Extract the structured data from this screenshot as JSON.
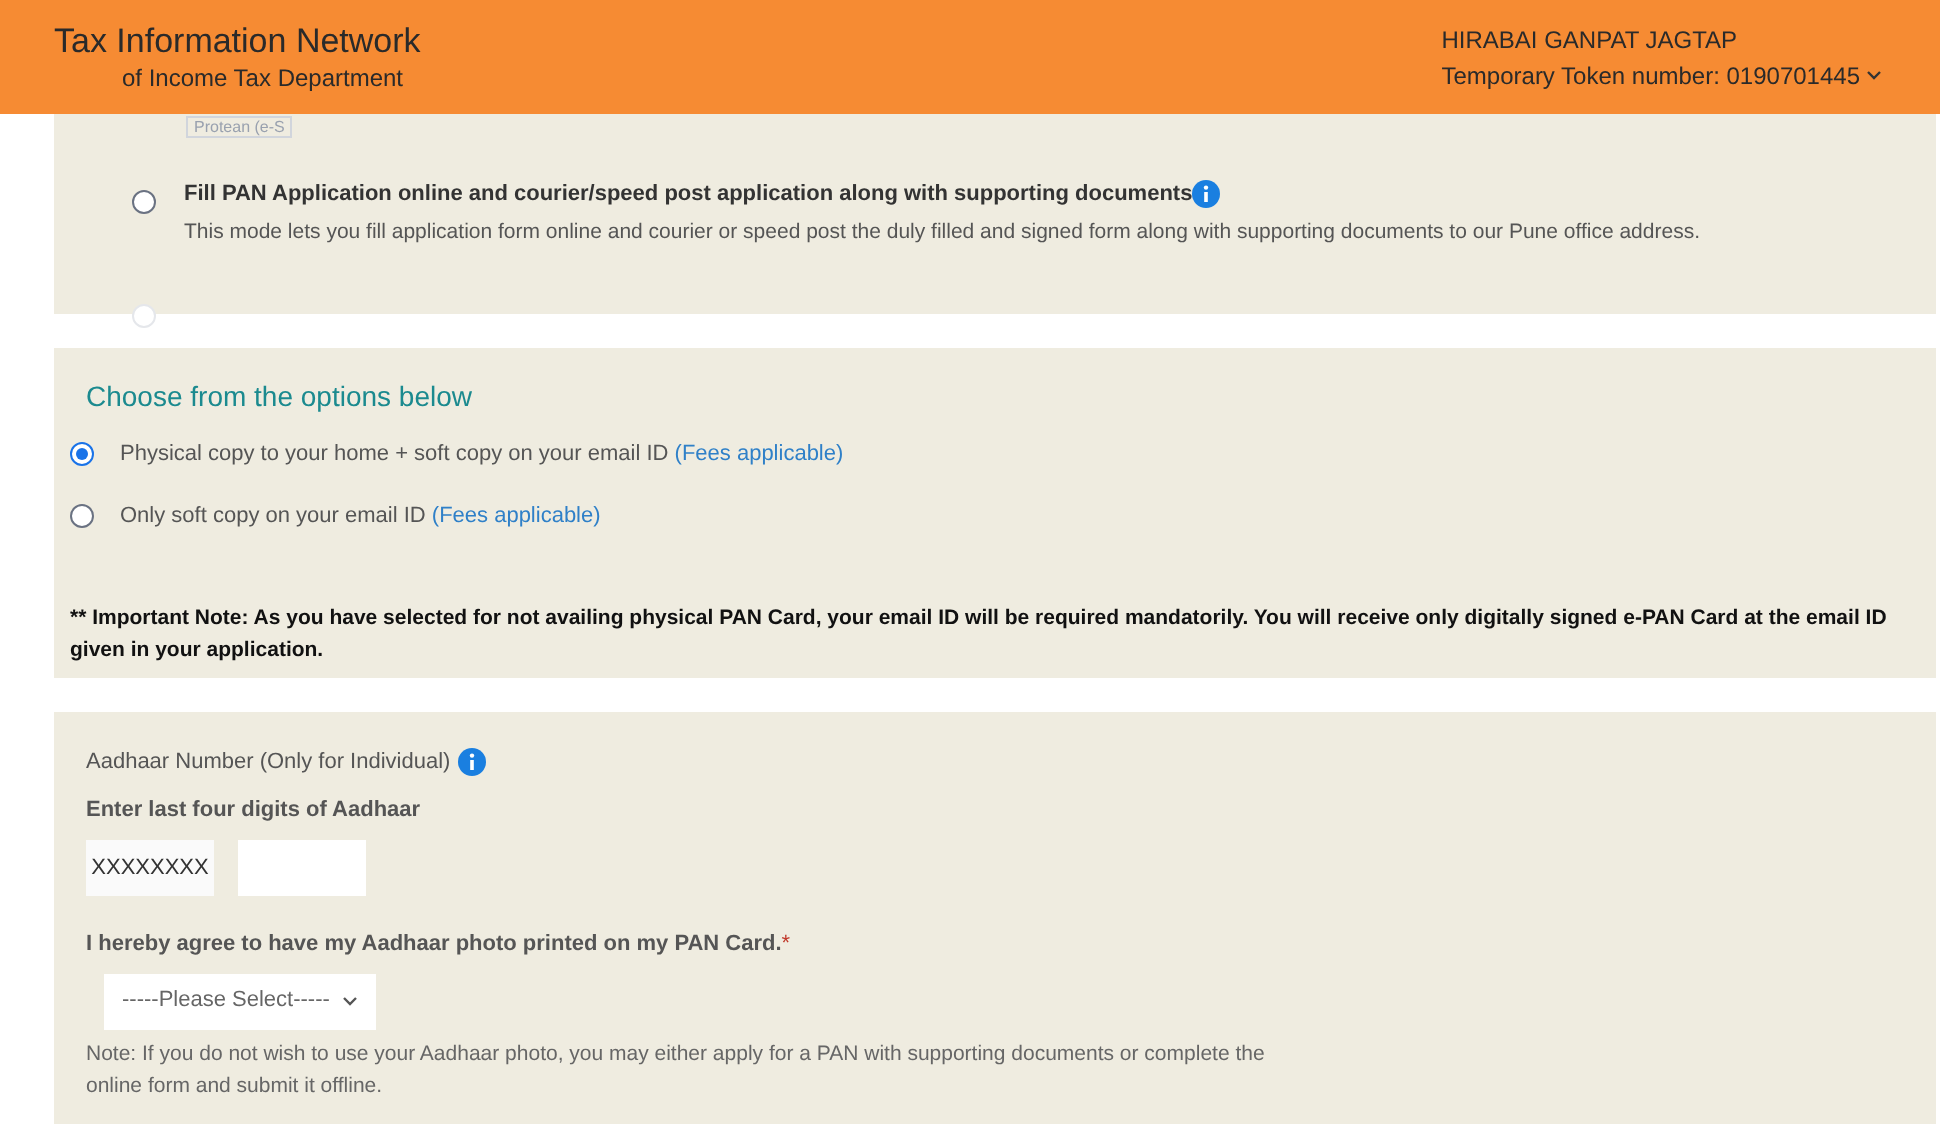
{
  "header": {
    "title": "Tax Information Network",
    "subtitle": "of Income Tax Department",
    "user_name": "HIRABAI GANPAT JAGTAP",
    "token": "Temporary Token number: 0190701445"
  },
  "agency_select": {
    "value": "Protean (e-S"
  },
  "application_modes": [
    {
      "title": "Fill PAN Application online and courier/speed post application along with supporting documents",
      "description": "This mode lets you fill application form online and courier or speed post the duly filled and signed form along with supporting documents to our Pune office address.",
      "selected": false,
      "disabled": false
    },
    {
      "selected": false,
      "disabled": true
    }
  ],
  "delivery": {
    "heading": "Choose from the options below",
    "options": [
      {
        "label": "Physical copy to your home + soft copy on your email ID",
        "fees": "(Fees applicable)",
        "selected": true
      },
      {
        "label": "Only soft copy on your email ID",
        "fees": "(Fees applicable)",
        "selected": false
      }
    ],
    "note": "** Important Note: As you have selected for not availing physical PAN Card, your email ID will be required mandatorily. You will receive only digitally signed e-PAN Card at the email ID given in your application."
  },
  "aadhaar": {
    "label": "Aadhaar Number (Only for Individual)",
    "digits_label": "Enter last four digits of Aadhaar",
    "masked_value": "XXXXXXXX",
    "photo_question": "I hereby agree to have my Aadhaar photo printed on my PAN Card.",
    "required_mark": "*",
    "photo_select": "-----Please Select-----",
    "note": "Note: If you do not wish to use your Aadhaar photo, you may either apply for a PAN with supporting documents or complete the online form and submit it offline."
  }
}
